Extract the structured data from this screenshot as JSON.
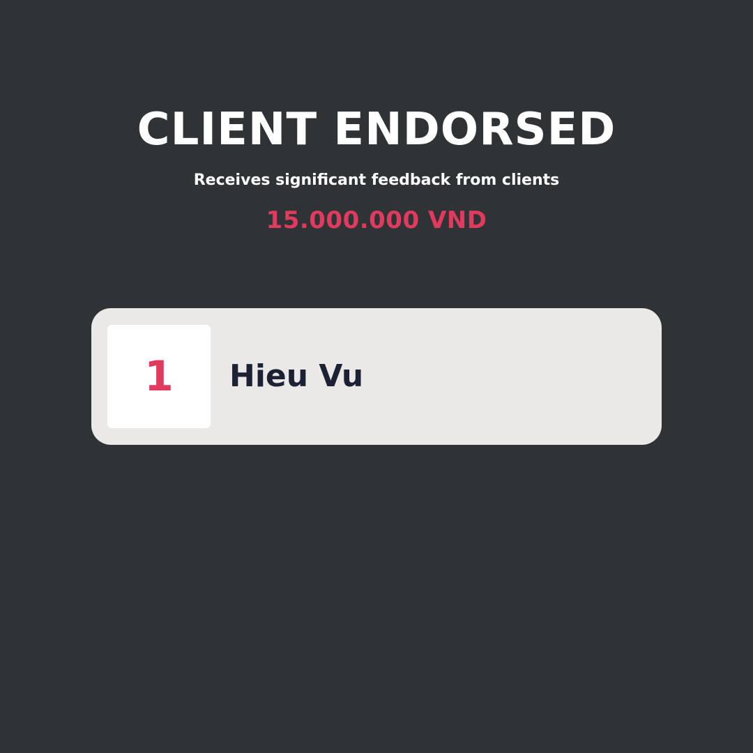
{
  "award": {
    "title": "CLIENT ENDORSED",
    "subtitle": "Receives significant feedback from clients",
    "prize": "15.000.000 VND"
  },
  "winners": [
    {
      "rank": "1",
      "name": "Hieu Vu"
    }
  ],
  "colors": {
    "background": "#303336",
    "card": "#eae9e8",
    "rank_box": "#ffffff",
    "accent": "#e03a5e",
    "name_text": "#1c2233",
    "heading_text": "#ffffff"
  }
}
